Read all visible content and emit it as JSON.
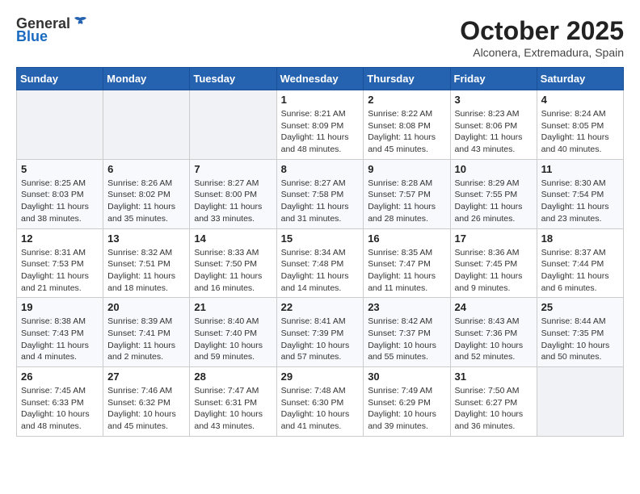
{
  "header": {
    "logo_general": "General",
    "logo_blue": "Blue",
    "month_title": "October 2025",
    "location": "Alconera, Extremadura, Spain"
  },
  "weekdays": [
    "Sunday",
    "Monday",
    "Tuesday",
    "Wednesday",
    "Thursday",
    "Friday",
    "Saturday"
  ],
  "weeks": [
    [
      {
        "day": "",
        "info": ""
      },
      {
        "day": "",
        "info": ""
      },
      {
        "day": "",
        "info": ""
      },
      {
        "day": "1",
        "info": "Sunrise: 8:21 AM\nSunset: 8:09 PM\nDaylight: 11 hours and 48 minutes."
      },
      {
        "day": "2",
        "info": "Sunrise: 8:22 AM\nSunset: 8:08 PM\nDaylight: 11 hours and 45 minutes."
      },
      {
        "day": "3",
        "info": "Sunrise: 8:23 AM\nSunset: 8:06 PM\nDaylight: 11 hours and 43 minutes."
      },
      {
        "day": "4",
        "info": "Sunrise: 8:24 AM\nSunset: 8:05 PM\nDaylight: 11 hours and 40 minutes."
      }
    ],
    [
      {
        "day": "5",
        "info": "Sunrise: 8:25 AM\nSunset: 8:03 PM\nDaylight: 11 hours and 38 minutes."
      },
      {
        "day": "6",
        "info": "Sunrise: 8:26 AM\nSunset: 8:02 PM\nDaylight: 11 hours and 35 minutes."
      },
      {
        "day": "7",
        "info": "Sunrise: 8:27 AM\nSunset: 8:00 PM\nDaylight: 11 hours and 33 minutes."
      },
      {
        "day": "8",
        "info": "Sunrise: 8:27 AM\nSunset: 7:58 PM\nDaylight: 11 hours and 31 minutes."
      },
      {
        "day": "9",
        "info": "Sunrise: 8:28 AM\nSunset: 7:57 PM\nDaylight: 11 hours and 28 minutes."
      },
      {
        "day": "10",
        "info": "Sunrise: 8:29 AM\nSunset: 7:55 PM\nDaylight: 11 hours and 26 minutes."
      },
      {
        "day": "11",
        "info": "Sunrise: 8:30 AM\nSunset: 7:54 PM\nDaylight: 11 hours and 23 minutes."
      }
    ],
    [
      {
        "day": "12",
        "info": "Sunrise: 8:31 AM\nSunset: 7:53 PM\nDaylight: 11 hours and 21 minutes."
      },
      {
        "day": "13",
        "info": "Sunrise: 8:32 AM\nSunset: 7:51 PM\nDaylight: 11 hours and 18 minutes."
      },
      {
        "day": "14",
        "info": "Sunrise: 8:33 AM\nSunset: 7:50 PM\nDaylight: 11 hours and 16 minutes."
      },
      {
        "day": "15",
        "info": "Sunrise: 8:34 AM\nSunset: 7:48 PM\nDaylight: 11 hours and 14 minutes."
      },
      {
        "day": "16",
        "info": "Sunrise: 8:35 AM\nSunset: 7:47 PM\nDaylight: 11 hours and 11 minutes."
      },
      {
        "day": "17",
        "info": "Sunrise: 8:36 AM\nSunset: 7:45 PM\nDaylight: 11 hours and 9 minutes."
      },
      {
        "day": "18",
        "info": "Sunrise: 8:37 AM\nSunset: 7:44 PM\nDaylight: 11 hours and 6 minutes."
      }
    ],
    [
      {
        "day": "19",
        "info": "Sunrise: 8:38 AM\nSunset: 7:43 PM\nDaylight: 11 hours and 4 minutes."
      },
      {
        "day": "20",
        "info": "Sunrise: 8:39 AM\nSunset: 7:41 PM\nDaylight: 11 hours and 2 minutes."
      },
      {
        "day": "21",
        "info": "Sunrise: 8:40 AM\nSunset: 7:40 PM\nDaylight: 10 hours and 59 minutes."
      },
      {
        "day": "22",
        "info": "Sunrise: 8:41 AM\nSunset: 7:39 PM\nDaylight: 10 hours and 57 minutes."
      },
      {
        "day": "23",
        "info": "Sunrise: 8:42 AM\nSunset: 7:37 PM\nDaylight: 10 hours and 55 minutes."
      },
      {
        "day": "24",
        "info": "Sunrise: 8:43 AM\nSunset: 7:36 PM\nDaylight: 10 hours and 52 minutes."
      },
      {
        "day": "25",
        "info": "Sunrise: 8:44 AM\nSunset: 7:35 PM\nDaylight: 10 hours and 50 minutes."
      }
    ],
    [
      {
        "day": "26",
        "info": "Sunrise: 7:45 AM\nSunset: 6:33 PM\nDaylight: 10 hours and 48 minutes."
      },
      {
        "day": "27",
        "info": "Sunrise: 7:46 AM\nSunset: 6:32 PM\nDaylight: 10 hours and 45 minutes."
      },
      {
        "day": "28",
        "info": "Sunrise: 7:47 AM\nSunset: 6:31 PM\nDaylight: 10 hours and 43 minutes."
      },
      {
        "day": "29",
        "info": "Sunrise: 7:48 AM\nSunset: 6:30 PM\nDaylight: 10 hours and 41 minutes."
      },
      {
        "day": "30",
        "info": "Sunrise: 7:49 AM\nSunset: 6:29 PM\nDaylight: 10 hours and 39 minutes."
      },
      {
        "day": "31",
        "info": "Sunrise: 7:50 AM\nSunset: 6:27 PM\nDaylight: 10 hours and 36 minutes."
      },
      {
        "day": "",
        "info": ""
      }
    ]
  ]
}
